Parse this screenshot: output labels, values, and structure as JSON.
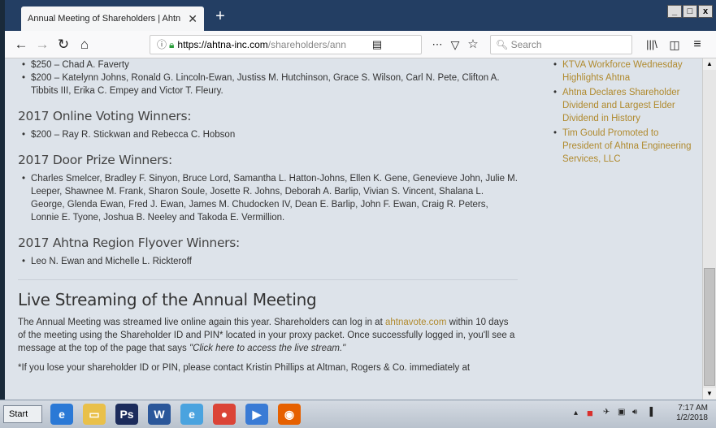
{
  "browser": {
    "tab_title": "Annual Meeting of Shareholders | Ahtn",
    "tab_close": "✕",
    "new_tab": "+",
    "window_buttons": [
      "_",
      "□",
      "x"
    ],
    "url_domain": "https://ahtna-inc.com",
    "url_path": "/shareholders/ann",
    "search_placeholder": "Search",
    "icons": [
      "back-icon",
      "forward-icon",
      "reload-icon",
      "home-icon",
      "info-icon",
      "lock-icon",
      "reader-icon",
      "more-icon",
      "pocket-icon",
      "bookmark-star-icon",
      "download-icon",
      "library-icon",
      "sidebar-icon",
      "menu-icon"
    ]
  },
  "main": {
    "first_items": [
      "$250 – Chad A. Faverty",
      "$200 – Katelynn Johns, Ronald G. Lincoln-Ewan, Justiss M. Hutchinson, Grace S. Wilson, Carl N. Pete, Clifton A. Tibbits III, Erika C. Empey and Victor T. Fleury."
    ],
    "online_voting_heading": "2017 Online Voting Winners:",
    "online_voting_items": [
      "$200 – Ray R. Stickwan and Rebecca C. Hobson"
    ],
    "door_prize_heading": "2017 Door Prize Winners:",
    "door_prize_items": [
      "Charles Smelcer, Bradley F. Sinyon, Bruce Lord, Samantha L. Hatton-Johns, Ellen K. Gene, Genevieve John, Julie M. Leeper, Shawnee M. Frank, Sharon Soule, Josette R. Johns, Deborah A. Barlip, Vivian S. Vincent, Shalana L. George, Glenda Ewan, Fred J. Ewan, James M. Chudocken IV, Dean E. Barlip, John F. Ewan, Craig R. Peters, Lonnie E. Tyone, Joshua B. Neeley and Takoda E. Vermillion."
    ],
    "flyover_heading": "2017 Ahtna Region Flyover Winners:",
    "flyover_items": [
      "Leo N. Ewan and Michelle L. Rickteroff"
    ],
    "live_heading": "Live Streaming of the Annual Meeting",
    "live_para_1": "The Annual Meeting was streamed live online again this year.  Shareholders can log in at ",
    "live_link": "ahtnavote.com",
    "live_para_2": " within 10 days of the meeting using the Shareholder ID and PIN* located in your proxy packet. Once successfully logged in, you'll see a message at the top of the page that says ",
    "live_para_quote": "\"Click here to access the live stream.\"",
    "footnote": "*If you lose your shareholder ID or PIN, please contact Kristin Phillips at Altman, Rogers & Co. immediately at"
  },
  "sidebar": {
    "links": [
      "KTVA Workforce Wednesday Highlights Ahtna",
      "Ahtna Declares Shareholder Dividend and Largest Elder Dividend in History",
      "Tim Gould Promoted to President of Ahtna Engineering Services, LLC"
    ]
  },
  "taskbar": {
    "start_label": "Start",
    "apps": [
      {
        "name": "ie-icon",
        "color": "#2b79d6",
        "glyph": "e"
      },
      {
        "name": "explorer-icon",
        "color": "#e9c04a",
        "glyph": "▭"
      },
      {
        "name": "photoshop-icon",
        "color": "#1c2c5c",
        "glyph": "Ps"
      },
      {
        "name": "word-icon",
        "color": "#2b579a",
        "glyph": "W"
      },
      {
        "name": "ie-alt-icon",
        "color": "#4aa3df",
        "glyph": "e"
      },
      {
        "name": "chrome-icon",
        "color": "#db4437",
        "glyph": "●"
      },
      {
        "name": "media-player-icon",
        "color": "#3a7bd5",
        "glyph": "▶"
      },
      {
        "name": "firefox-icon",
        "color": "#e66000",
        "glyph": "◉"
      }
    ],
    "time": "7:17 AM",
    "date": "1/2/2018"
  },
  "colors": {
    "link": "#b08a2e",
    "titlebar": "#233e63",
    "page_bg": "#dde3ea"
  }
}
